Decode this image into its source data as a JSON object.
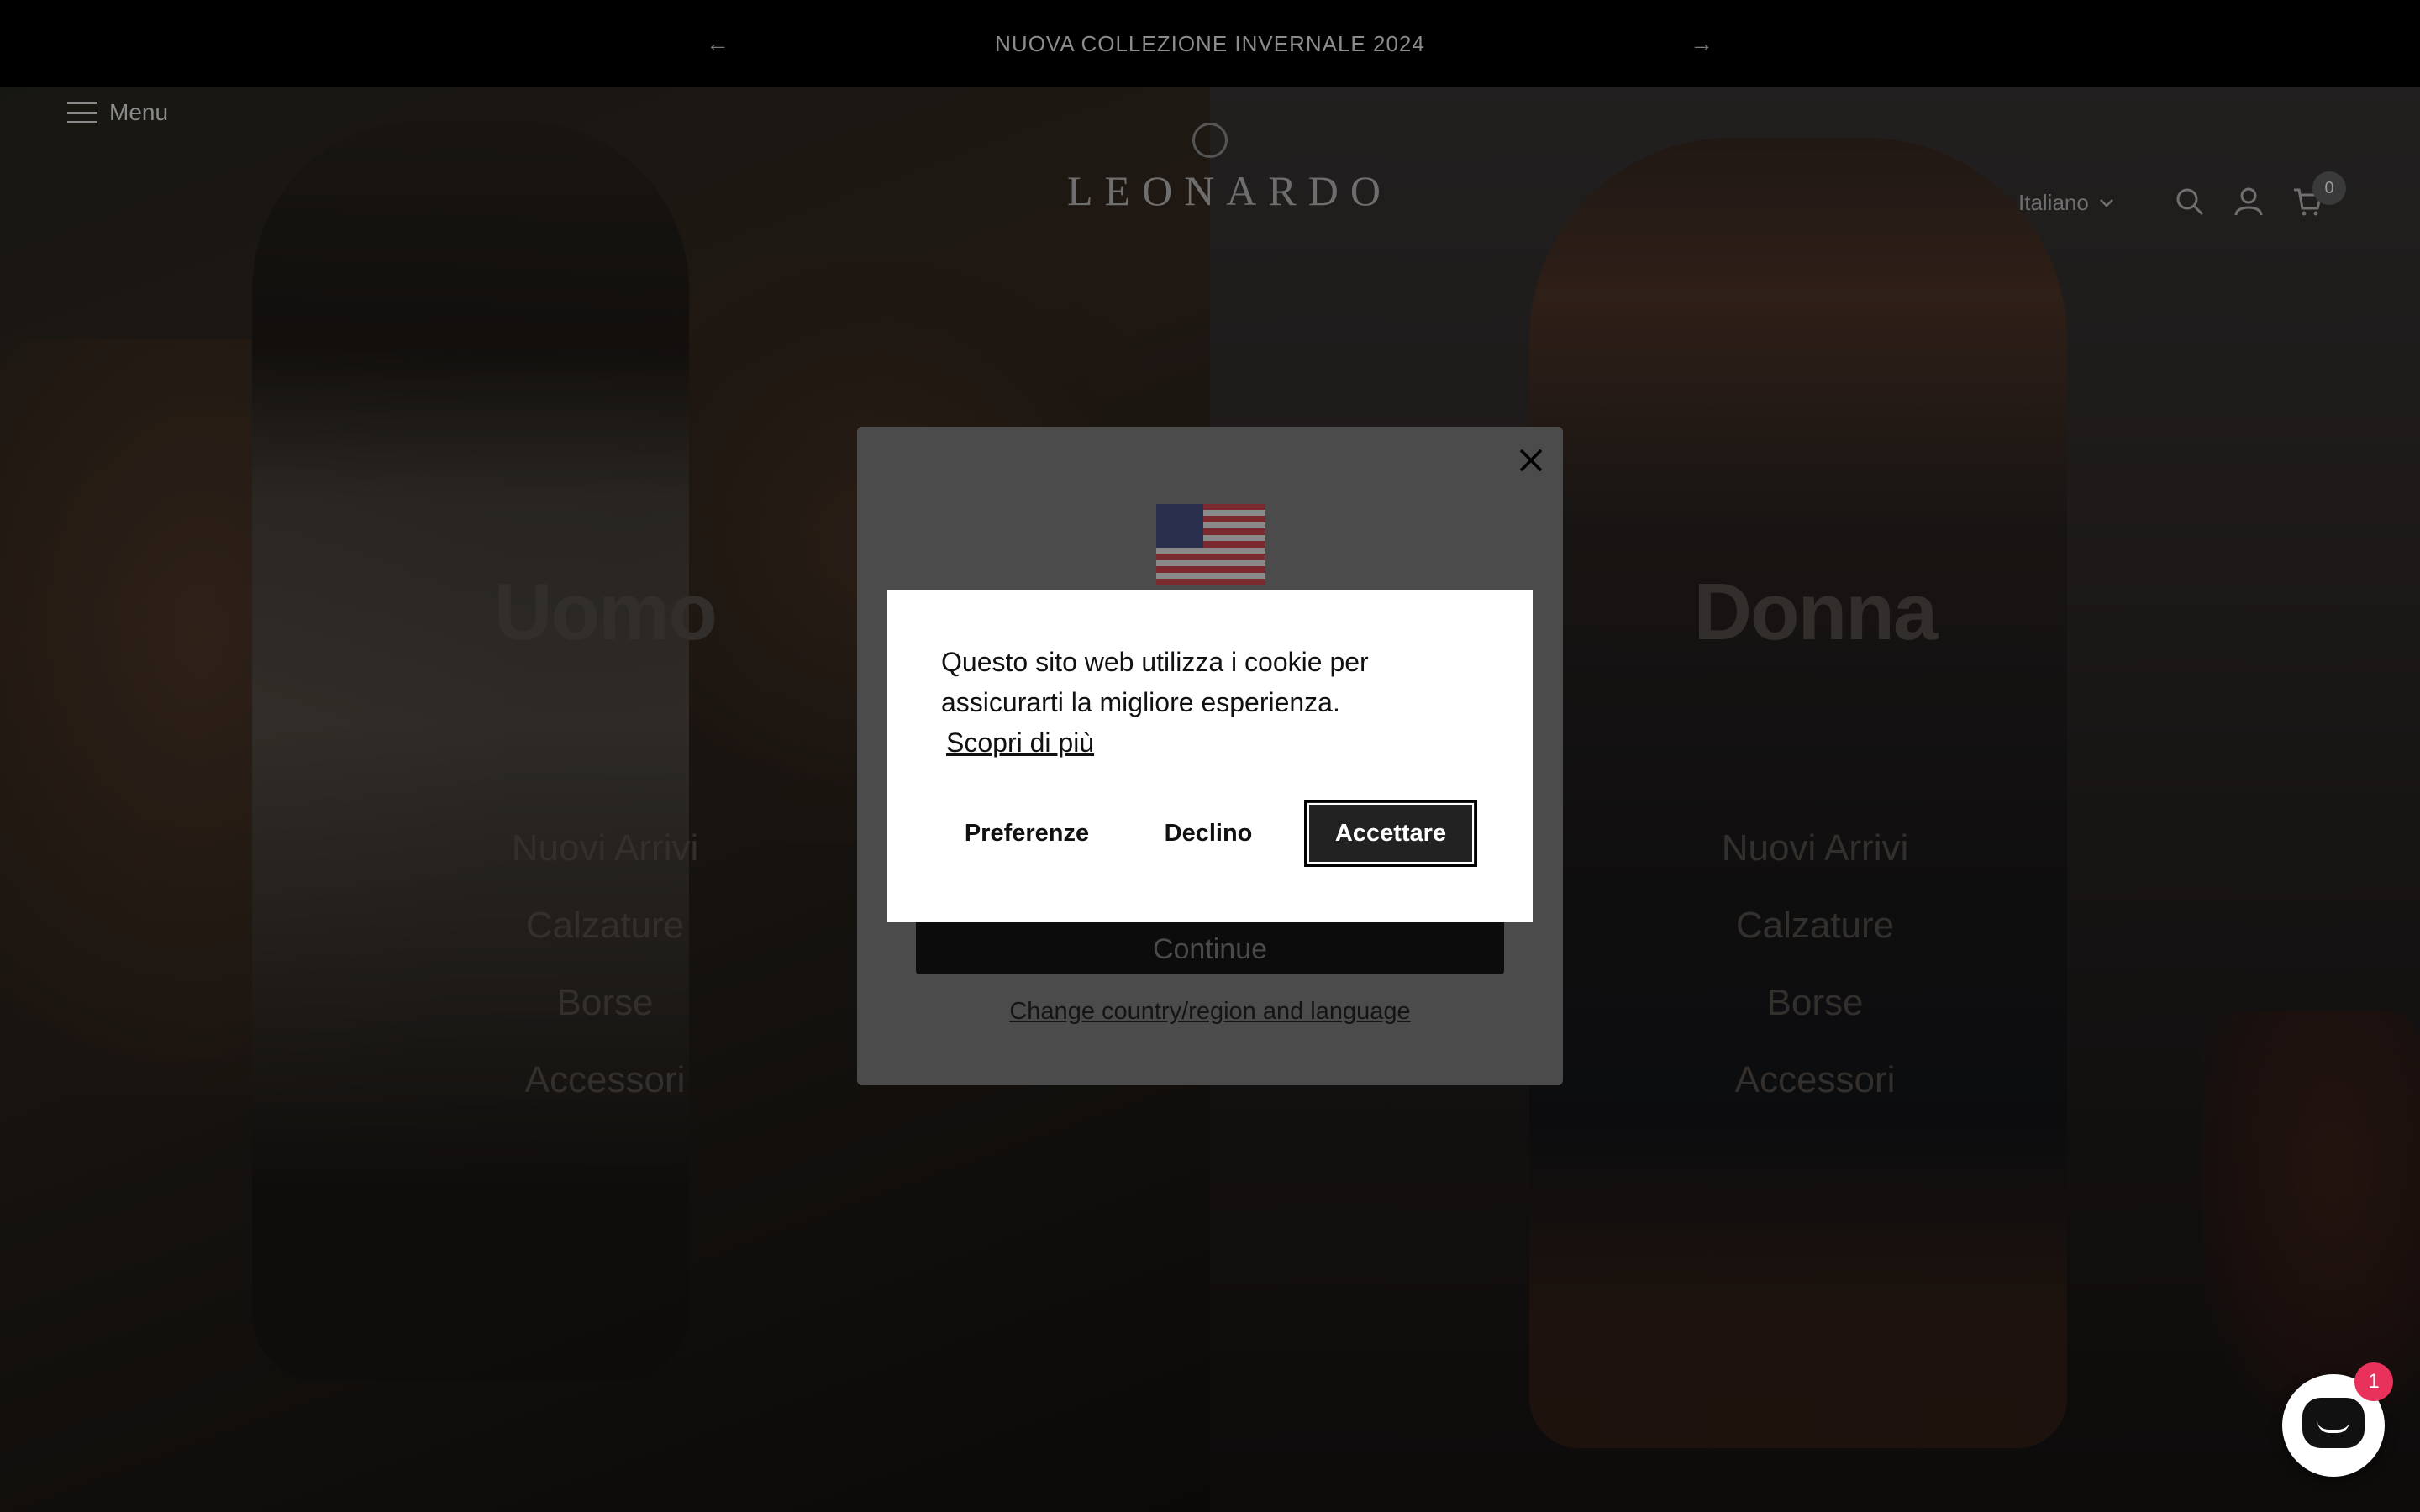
{
  "announcement": {
    "text": "NUOVA COLLEZIONE INVERNALE 2024",
    "prev_icon": "arrow-left-icon",
    "next_icon": "arrow-right-icon"
  },
  "header": {
    "menu_label": "Menu",
    "logo_text": "LEONARDO",
    "language": "Italiano",
    "cart_count": "0",
    "icons": [
      "search-icon",
      "account-icon",
      "cart-icon"
    ]
  },
  "hero": {
    "left": {
      "title": "Uomo",
      "links": [
        "Nuovi Arrivi",
        "Calzature",
        "Borse",
        "Accessori"
      ]
    },
    "right": {
      "title": "Donna",
      "links": [
        "Nuovi Arrivi",
        "Calzature",
        "Borse",
        "Accessori"
      ]
    }
  },
  "country_modal": {
    "flag_icon": "us-flag-icon",
    "continue_label": "Continue",
    "change_link": "Change country/region and language"
  },
  "cookie_banner": {
    "text": "Questo sito web utilizza i cookie per assicurarti la migliore esperienza.",
    "learn_more": "Scopri di più",
    "preferences": "Preferenze",
    "decline": "Declino",
    "accept": "Accettare"
  },
  "chat": {
    "badge_count": "1"
  },
  "colors": {
    "accept_button": "#222222",
    "chat_badge": "#e8315b",
    "announcement_bg": "#000000"
  }
}
